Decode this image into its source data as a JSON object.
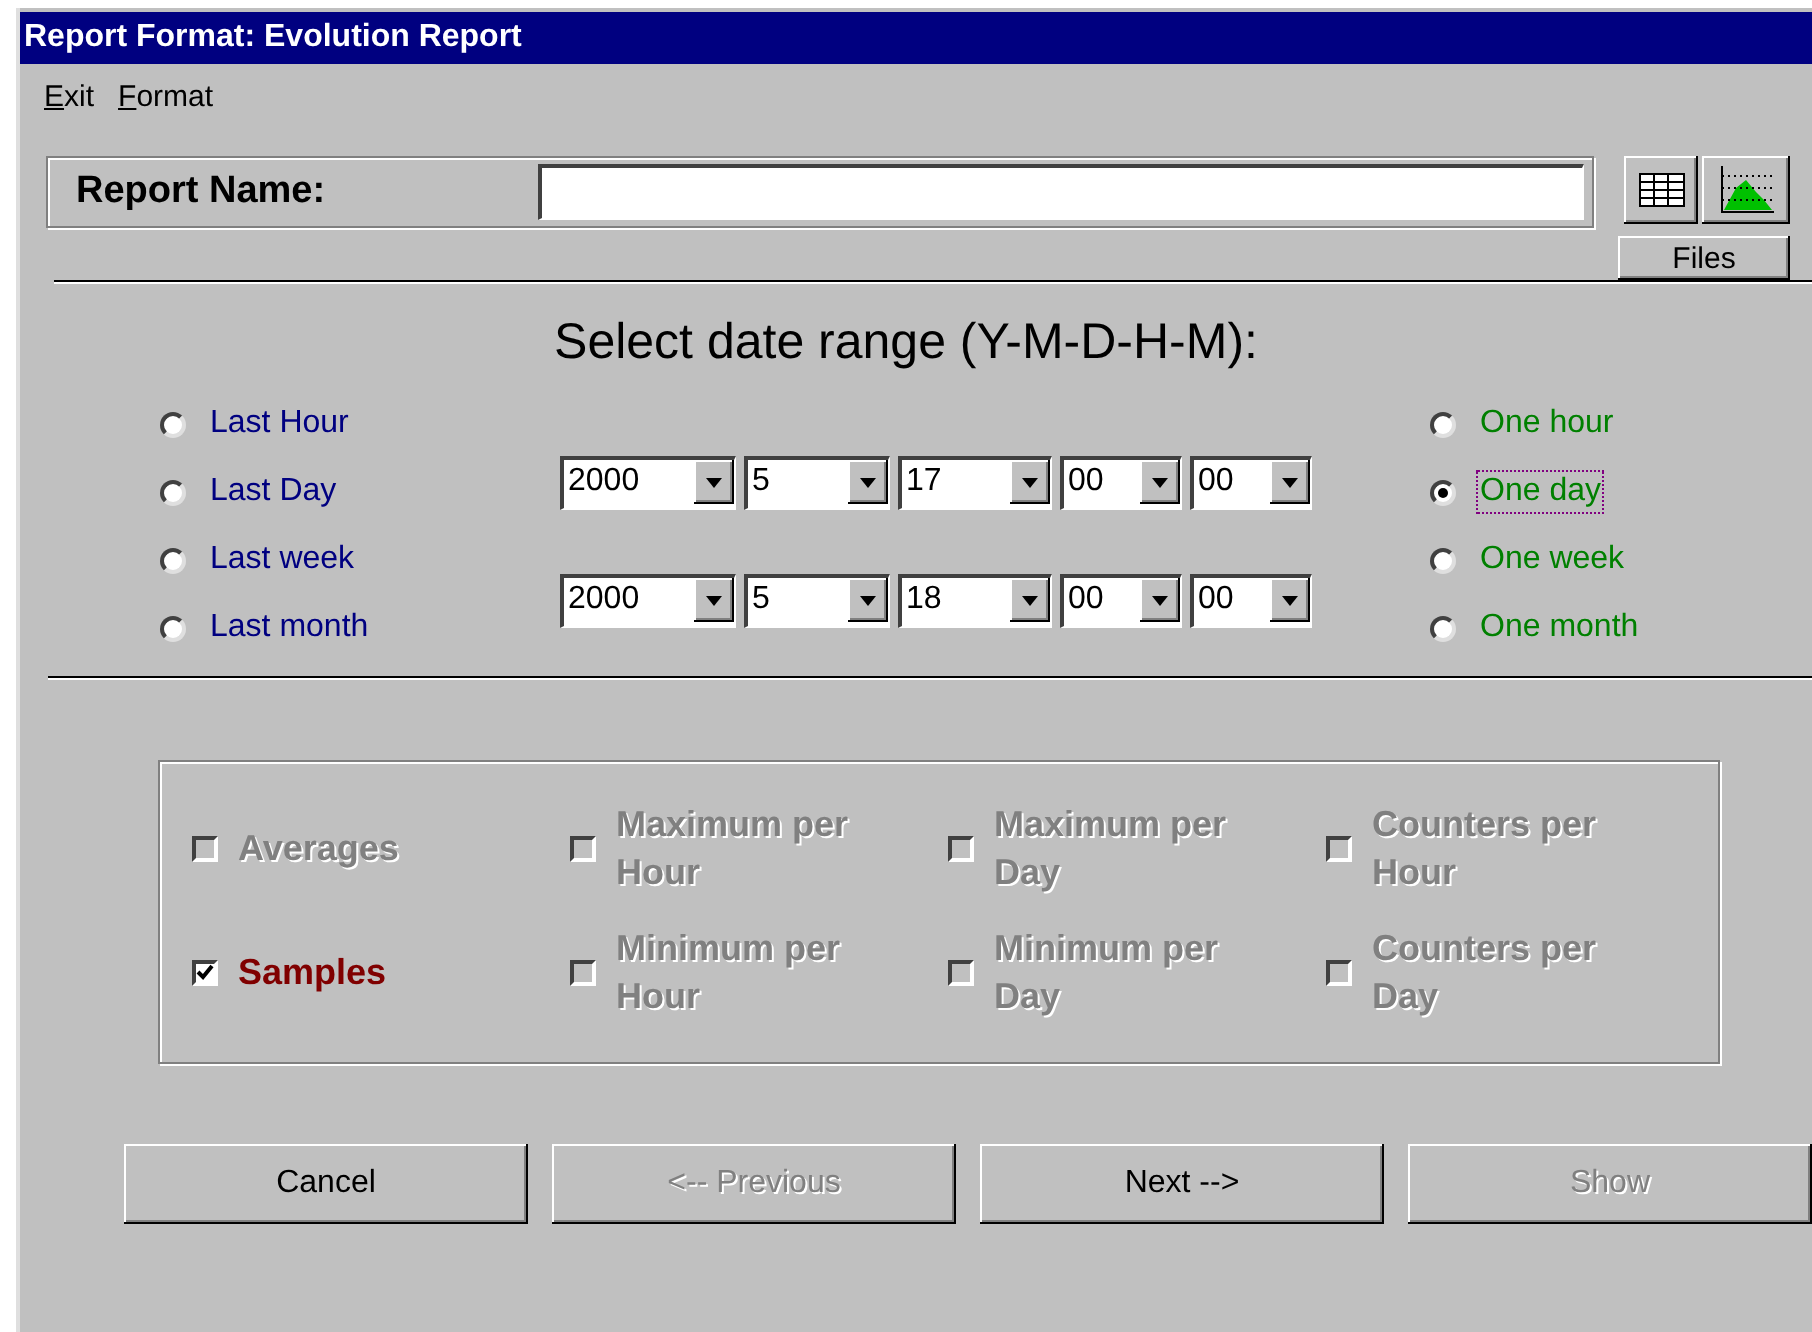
{
  "window": {
    "title": "Report Format: Evolution Report"
  },
  "menu": [
    {
      "label": "Exit"
    },
    {
      "label": "Format"
    }
  ],
  "report_name": {
    "label": "Report Name:"
  },
  "view_buttons": [
    {
      "kind": "table",
      "selected": false
    },
    {
      "kind": "chart",
      "selected": false
    }
  ],
  "files_button": {
    "label": "Files"
  },
  "heading": "Select date range (Y-M-D-H-M):",
  "relative_ranges": [
    {
      "label": "Last Hour",
      "selected": false
    },
    {
      "label": "Last Day",
      "selected": false
    },
    {
      "label": "Last week",
      "selected": false
    },
    {
      "label": "Last month",
      "selected": false
    }
  ],
  "date_rows": [
    {
      "year": "2000",
      "month": "5",
      "day": "17",
      "hour": "00",
      "minute": "00"
    },
    {
      "year": "2000",
      "month": "5",
      "day": "18",
      "hour": "00",
      "minute": "00"
    }
  ],
  "periods": [
    {
      "label": "One hour",
      "selected": false,
      "focused": false
    },
    {
      "label": "One day",
      "selected": true,
      "focused": true
    },
    {
      "label": "One week",
      "selected": false,
      "focused": false
    },
    {
      "label": "One month",
      "selected": false,
      "focused": false
    }
  ],
  "options": [
    {
      "label": "Averages",
      "checked": false,
      "disabled": true
    },
    {
      "label": "Maximum per Hour",
      "checked": false,
      "disabled": true
    },
    {
      "label": "Maximum per Day",
      "checked": false,
      "disabled": true
    },
    {
      "label": "Counters per Hour",
      "checked": false,
      "disabled": true
    },
    {
      "label": "Samples",
      "checked": true,
      "disabled": false
    },
    {
      "label": "Minimum per Hour",
      "checked": false,
      "disabled": true
    },
    {
      "label": "Minimum per Day",
      "checked": false,
      "disabled": true
    },
    {
      "label": "Counters per Day",
      "checked": false,
      "disabled": true
    }
  ],
  "buttons": [
    {
      "label": "Cancel",
      "disabled": false
    },
    {
      "label": "<-- Previous",
      "disabled": true
    },
    {
      "label": "Next -->",
      "disabled": false
    },
    {
      "label": "Show",
      "disabled": true
    }
  ]
}
